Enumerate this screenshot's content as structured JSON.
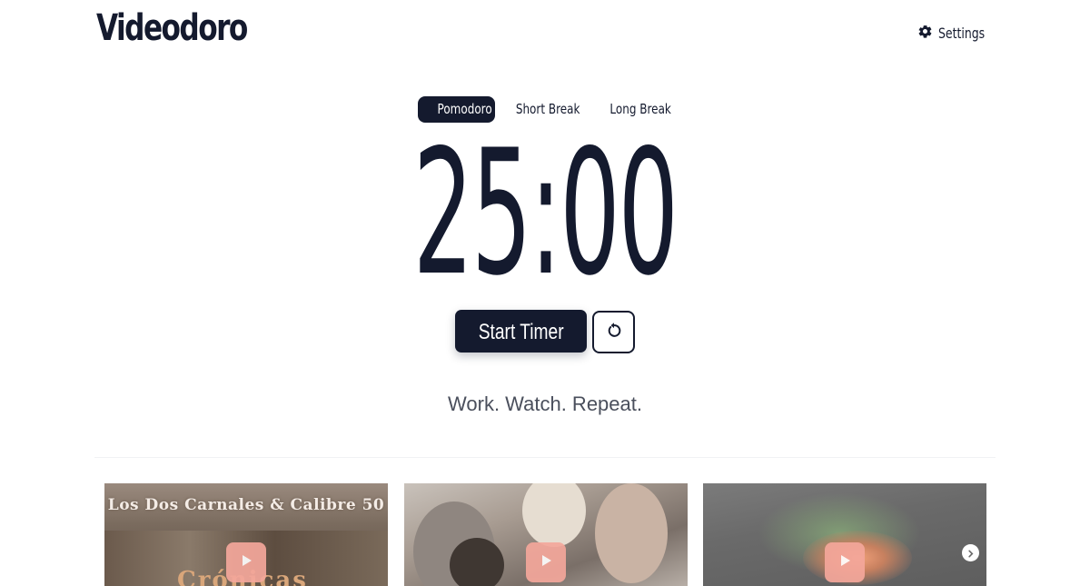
{
  "app": {
    "logo": "Videodoro",
    "settings_label": "Settings"
  },
  "icons": {
    "settings": "gear-icon",
    "reset": "reset-icon",
    "play": "play-icon",
    "next": "chevron-right-icon"
  },
  "tabs": [
    {
      "label": "Pomodoro",
      "active": true
    },
    {
      "label": "Short Break",
      "active": false
    },
    {
      "label": "Long Break",
      "active": false
    }
  ],
  "timer": {
    "display": "25:00"
  },
  "controls": {
    "start_label": "Start Timer"
  },
  "tagline": "Work. Watch. Repeat.",
  "videos": [
    {
      "overlay_title": "Los Dos Carnales & Calibre 50",
      "overlay_subtitle": "Crónicas"
    },
    {
      "overlay_title": ""
    },
    {
      "overlay_title": ""
    }
  ],
  "colors": {
    "primary": "#141a2e",
    "play_button": "#f4a79b",
    "tagline": "#4a4f5c"
  }
}
